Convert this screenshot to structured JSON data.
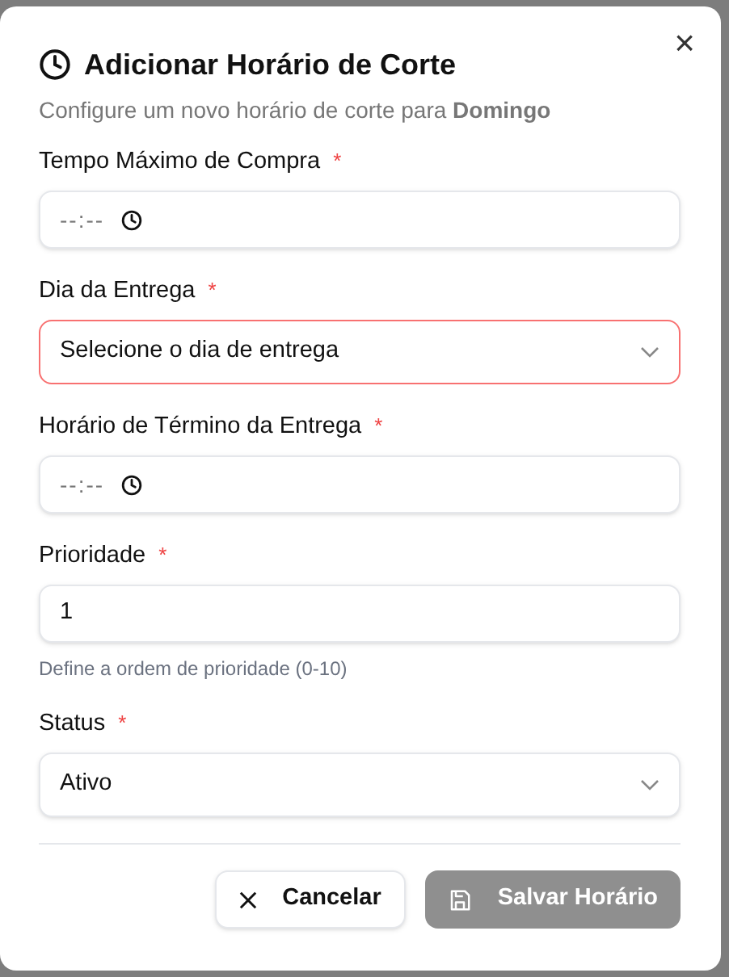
{
  "dialog": {
    "title": "Adicionar Horário de Corte",
    "subtitle": "Configure um novo horário de corte para **Domingo**",
    "close": "×"
  },
  "fields": [
    {
      "kind": "time",
      "label": "Tempo Máximo de Compra",
      "required_mark": "*",
      "placeholder": "--:--",
      "invalid": false
    },
    {
      "kind": "select",
      "label": "Dia da Entrega",
      "required_mark": "*",
      "value": "Selecione o dia de entrega",
      "invalid": true
    },
    {
      "kind": "time",
      "label": "Horário de Término da Entrega",
      "required_mark": "*",
      "placeholder": "--:--",
      "invalid": false
    },
    {
      "kind": "number",
      "label": "Prioridade",
      "required_mark": "*",
      "value": "1",
      "hint": "Define a ordem de prioridade (0-10)",
      "invalid": false
    },
    {
      "kind": "select",
      "label": "Status",
      "required_mark": "*",
      "value": "Ativo",
      "invalid": false
    }
  ],
  "buttons": [
    {
      "kind": "cancel",
      "label": "Cancelar",
      "disabled": false
    },
    {
      "kind": "save",
      "label": "Salvar Horário",
      "disabled": true
    }
  ]
}
